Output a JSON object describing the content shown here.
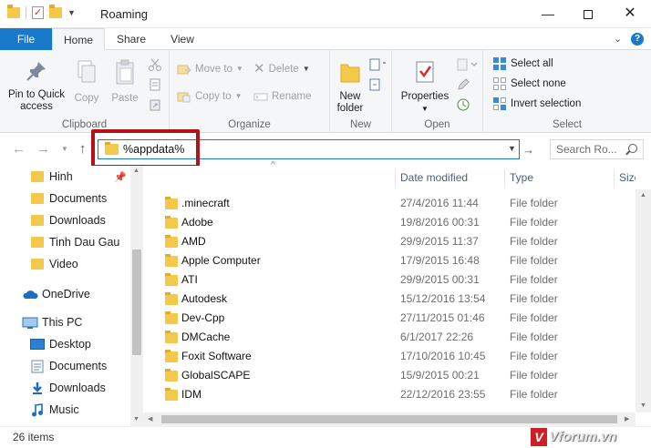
{
  "window": {
    "title": "Roaming",
    "minimize_glyph": "—",
    "close_glyph": "✕"
  },
  "ribbon_tabs": {
    "file": "File",
    "home": "Home",
    "share": "Share",
    "view": "View"
  },
  "ribbon": {
    "clipboard": {
      "label": "Clipboard",
      "pin": "Pin to Quick access",
      "copy": "Copy",
      "paste": "Paste"
    },
    "organize": {
      "label": "Organize",
      "move_to": "Move to",
      "copy_to": "Copy to",
      "delete": "Delete",
      "rename": "Rename"
    },
    "new": {
      "label": "New",
      "new_folder": "New folder"
    },
    "open": {
      "label": "Open",
      "properties": "Properties"
    },
    "select": {
      "label": "Select",
      "select_all": "Select all",
      "select_none": "Select none",
      "invert": "Invert selection"
    }
  },
  "address": {
    "value": "%appdata%",
    "search_placeholder": "Search Ro..."
  },
  "nav_pane": {
    "quick": [
      "Hinh",
      "Documents",
      "Downloads",
      "Tinh Dau Gau",
      "Video"
    ],
    "onedrive": "OneDrive",
    "this_pc": "This PC",
    "pc_items": [
      "Desktop",
      "Documents",
      "Downloads",
      "Music"
    ]
  },
  "columns": {
    "date": "Date modified",
    "type": "Type",
    "size": "Size"
  },
  "files": [
    {
      "name": ".minecraft",
      "date": "27/4/2016 11:44",
      "type": "File folder"
    },
    {
      "name": "Adobe",
      "date": "19/8/2016 00:31",
      "type": "File folder"
    },
    {
      "name": "AMD",
      "date": "29/9/2015 11:37",
      "type": "File folder"
    },
    {
      "name": "Apple Computer",
      "date": "17/9/2015 16:48",
      "type": "File folder"
    },
    {
      "name": "ATI",
      "date": "29/9/2015 00:31",
      "type": "File folder"
    },
    {
      "name": "Autodesk",
      "date": "15/12/2016 13:54",
      "type": "File folder"
    },
    {
      "name": "Dev-Cpp",
      "date": "27/11/2015 01:46",
      "type": "File folder"
    },
    {
      "name": "DMCache",
      "date": "6/1/2017 22:26",
      "type": "File folder"
    },
    {
      "name": "Foxit Software",
      "date": "17/10/2016 10:45",
      "type": "File folder"
    },
    {
      "name": "GlobalSCAPE",
      "date": "15/9/2015 00:21",
      "type": "File folder"
    },
    {
      "name": "IDM",
      "date": "22/12/2016 23:55",
      "type": "File folder"
    }
  ],
  "status": {
    "count": "26 items"
  },
  "watermark": {
    "logo": "V",
    "text": "Vforum.vn"
  },
  "colors": {
    "accent": "#1979ca",
    "folder": "#f4c84a",
    "highlight_box": "#b0141a"
  }
}
